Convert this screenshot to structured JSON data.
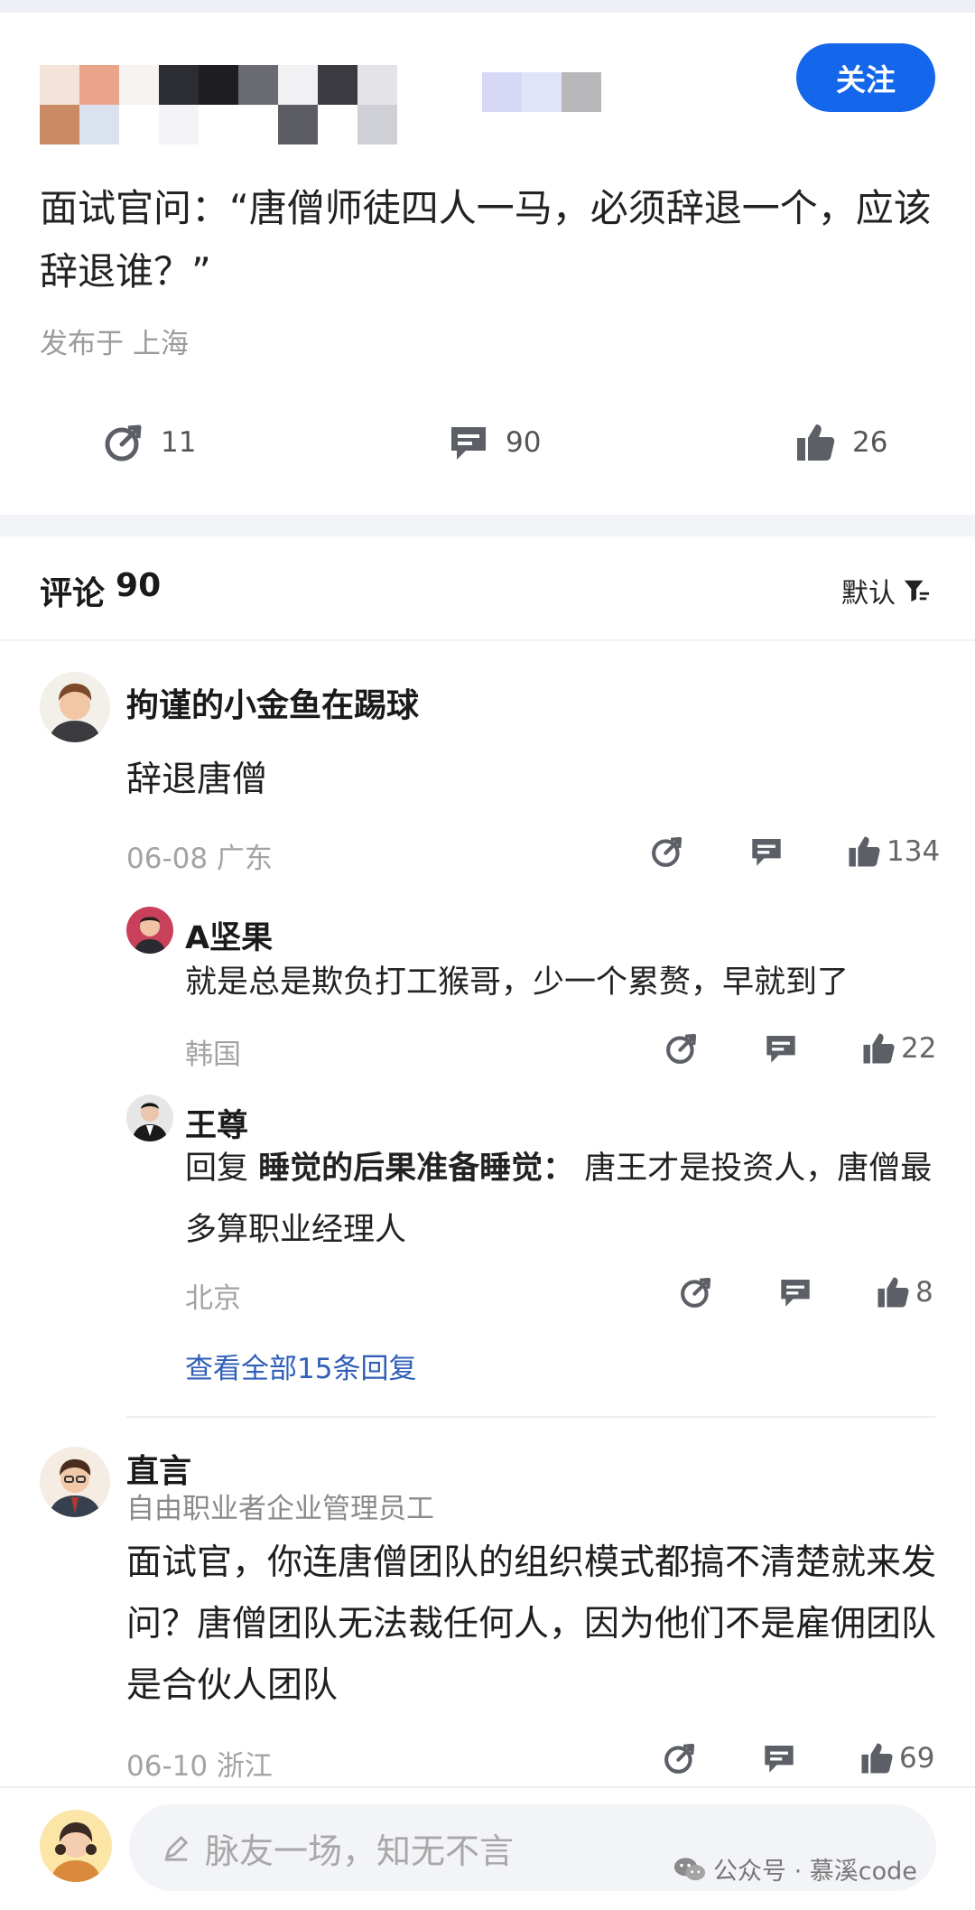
{
  "post": {
    "follow_label": "关注",
    "text": "面试官问：“唐僧师徒四人一马，必须辞退一个，应该辞退谁？”",
    "meta": "发布于 上海",
    "actions": [
      {
        "icon": "share-icon",
        "count": "11"
      },
      {
        "icon": "comment-icon",
        "count": "90"
      },
      {
        "icon": "like-icon",
        "count": "26"
      }
    ]
  },
  "comments_header": {
    "title": "评论",
    "count": "90",
    "sort_label": "默认"
  },
  "comments": [
    {
      "name": "拘谨的小金鱼在踢球",
      "text": "辞退唐僧",
      "meta": "06-08  广东",
      "likes": "134",
      "replies": [
        {
          "name": "A坚果",
          "text": "就是总是欺负打工猴哥，少一个累赘，早就到了",
          "meta": "韩国",
          "likes": "22"
        },
        {
          "name": "王尊",
          "reply_prefix": "回复 ",
          "reply_to": "睡觉的后果准备睡觉：",
          "text": " 唐王才是投资人，唐僧最多算职业经理人",
          "meta": "北京",
          "likes": "8"
        }
      ],
      "view_all": "查看全部15条回复"
    },
    {
      "name": "直言",
      "subtitle": "自由职业者企业管理员工",
      "text": "面试官，你连唐僧团队的组织模式都搞不清楚就来发问？唐僧团队无法裁任何人，因为他们不是雇佣团队是合伙人团队",
      "meta": "06-10  浙江",
      "likes": "69"
    }
  ],
  "input": {
    "placeholder": "脉友一场，知无不言"
  },
  "watermark": "公众号 · 慕溪code",
  "colors": {
    "accent": "#1466ea",
    "link": "#2f5fb7",
    "muted": "#a3a3a3"
  }
}
